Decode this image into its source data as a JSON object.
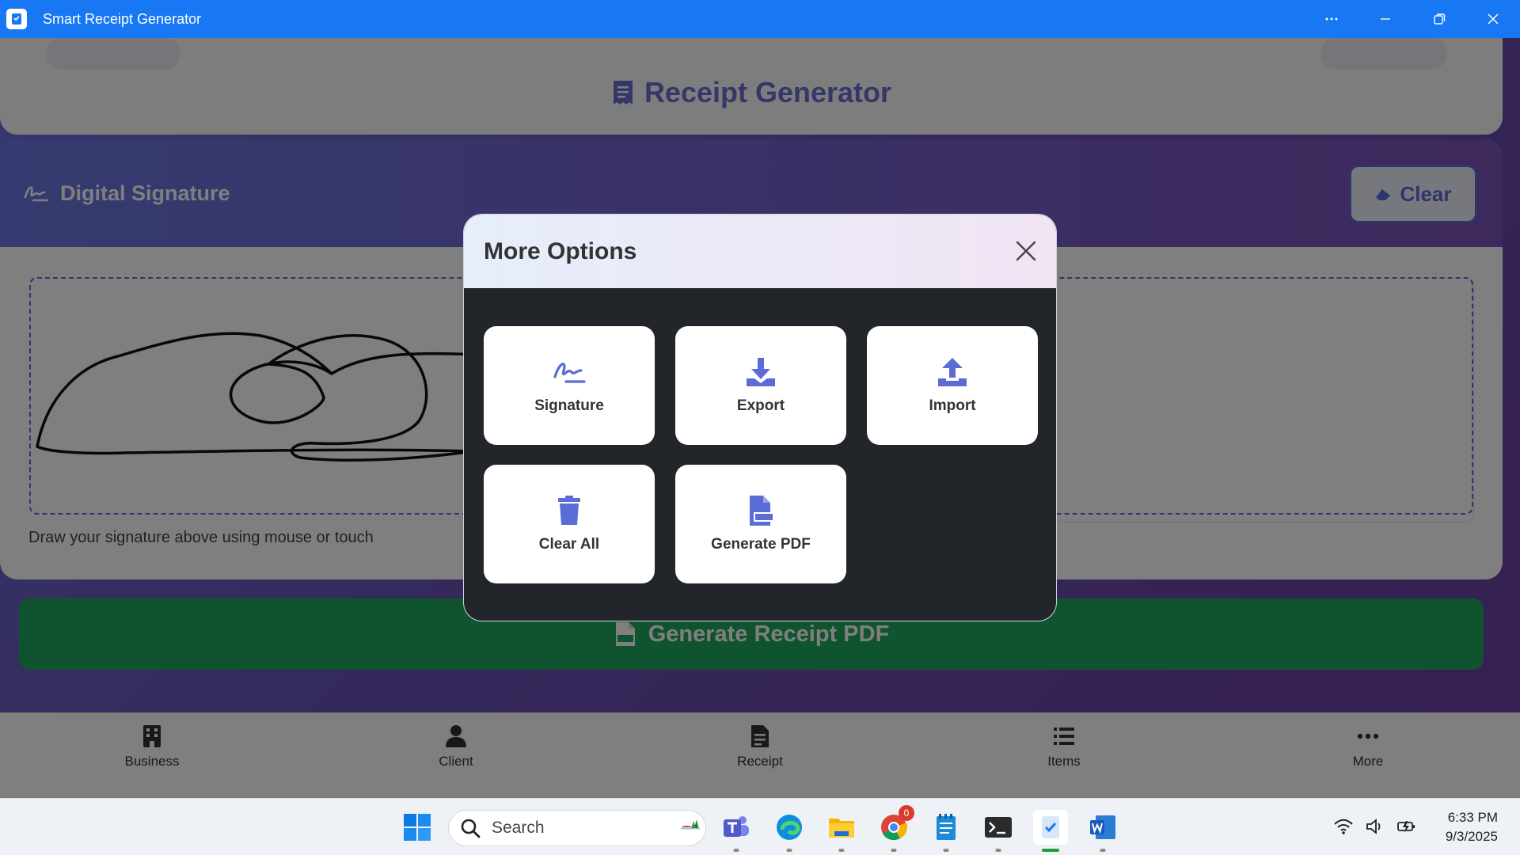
{
  "window": {
    "title": "Smart Receipt Generator",
    "more_label": "More",
    "minimize_label": "Minimize",
    "restore_label": "Restore",
    "close_label": "Close"
  },
  "header": {
    "title": "Receipt Generator"
  },
  "signature_section": {
    "title": "Digital Signature",
    "clear_button": "Clear",
    "hint": "Draw your signature above using mouse or touch"
  },
  "generate_button": "Generate Receipt PDF",
  "bottom_nav": [
    {
      "label": "Business",
      "icon": "building-icon"
    },
    {
      "label": "Client",
      "icon": "person-icon"
    },
    {
      "label": "Receipt",
      "icon": "receipt-icon"
    },
    {
      "label": "Items",
      "icon": "list-icon"
    },
    {
      "label": "More",
      "icon": "ellipsis-icon"
    }
  ],
  "modal": {
    "title": "More Options",
    "options": [
      {
        "label": "Signature",
        "icon": "signature-icon"
      },
      {
        "label": "Export",
        "icon": "download-icon"
      },
      {
        "label": "Import",
        "icon": "upload-icon"
      },
      {
        "label": "Clear All",
        "icon": "trash-icon"
      },
      {
        "label": "Generate PDF",
        "icon": "pdf-file-icon"
      }
    ]
  },
  "taskbar": {
    "search_placeholder": "Search",
    "chrome_badge": "0",
    "time": "6:33 PM",
    "date": "9/3/2025"
  },
  "colors": {
    "titlebar": "#1877f2",
    "accent": "#5b6cd6",
    "generate_green": "#1fa85e",
    "modal_body": "#22252a"
  }
}
